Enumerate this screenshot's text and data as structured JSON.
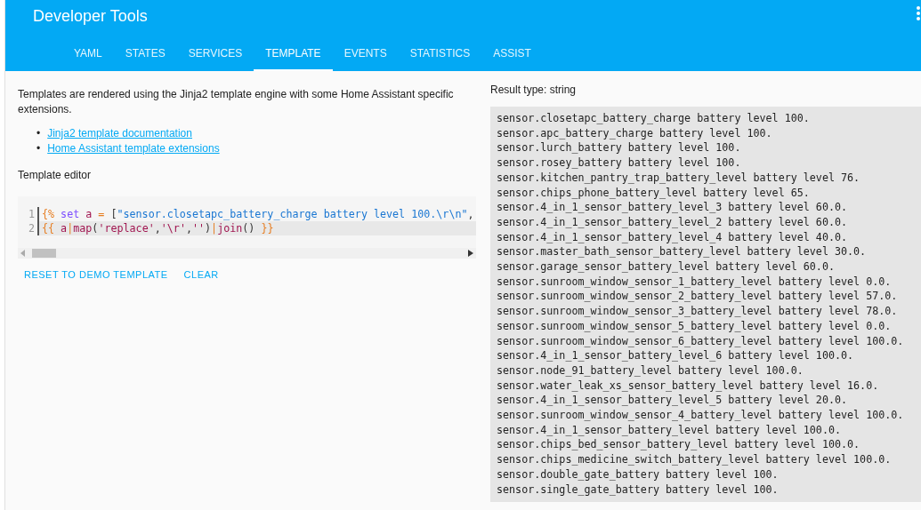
{
  "header": {
    "title": "Developer Tools"
  },
  "tabs": [
    {
      "label": "YAML",
      "selected": false
    },
    {
      "label": "STATES",
      "selected": false
    },
    {
      "label": "SERVICES",
      "selected": false
    },
    {
      "label": "TEMPLATE",
      "selected": true
    },
    {
      "label": "EVENTS",
      "selected": false
    },
    {
      "label": "STATISTICS",
      "selected": false
    },
    {
      "label": "ASSIST",
      "selected": false
    }
  ],
  "intro": "Templates are rendered using the Jinja2 template engine with some Home Assistant specific extensions.",
  "links": [
    {
      "bullet": "•",
      "label": "Jinja2 template documentation"
    },
    {
      "bullet": "•",
      "label": "Home Assistant template extensions"
    }
  ],
  "editor": {
    "label": "Template editor",
    "lines": [
      {
        "number": "1",
        "active": false,
        "tokens": [
          {
            "text": "{%",
            "kind": "delim"
          },
          {
            "text": " set",
            "kind": "keyword"
          },
          {
            "text": " a",
            "kind": "variable"
          },
          {
            "text": " =",
            "kind": "delim"
          },
          {
            "text": " [",
            "kind": "plain"
          },
          {
            "text": "\"sensor.closetapc_battery_charge battery level 100.\\r\\n\"",
            "kind": "string"
          },
          {
            "text": ",",
            "kind": "plain"
          }
        ]
      },
      {
        "number": "2",
        "active": true,
        "tokens": [
          {
            "text": "{{",
            "kind": "delim"
          },
          {
            "text": " a",
            "kind": "variable"
          },
          {
            "text": "|",
            "kind": "delim"
          },
          {
            "text": "map",
            "kind": "variable"
          },
          {
            "text": "(",
            "kind": "plain"
          },
          {
            "text": "'replace'",
            "kind": "variable"
          },
          {
            "text": ",",
            "kind": "plain"
          },
          {
            "text": "'\\r'",
            "kind": "variable"
          },
          {
            "text": ",",
            "kind": "plain"
          },
          {
            "text": "''",
            "kind": "variable"
          },
          {
            "text": ")",
            "kind": "plain"
          },
          {
            "text": "|",
            "kind": "delim"
          },
          {
            "text": "join",
            "kind": "variable"
          },
          {
            "text": "() ",
            "kind": "plain"
          },
          {
            "text": "}}",
            "kind": "delim"
          }
        ]
      }
    ]
  },
  "actions": [
    "RESET TO DEMO TEMPLATE",
    "CLEAR"
  ],
  "result": {
    "type_label": "Result type: string",
    "lines": [
      "sensor.closetapc_battery_charge battery level 100.",
      "sensor.apc_battery_charge battery level 100.",
      "sensor.lurch_battery battery level 100.",
      "sensor.rosey_battery battery level 100.",
      "sensor.kitchen_pantry_trap_battery_level battery level 76.",
      "sensor.chips_phone_battery_level battery level 65.",
      "sensor.4_in_1_sensor_battery_level_3 battery level 60.0.",
      "sensor.4_in_1_sensor_battery_level_2 battery level 60.0.",
      "sensor.4_in_1_sensor_battery_level_4 battery level 40.0.",
      "sensor.master_bath_sensor_battery_level battery level 30.0.",
      "sensor.garage_sensor_battery_level battery level 60.0.",
      "sensor.sunroom_window_sensor_1_battery_level battery level 0.0.",
      "sensor.sunroom_window_sensor_2_battery_level battery level 57.0.",
      "sensor.sunroom_window_sensor_3_battery_level battery level 78.0.",
      "sensor.sunroom_window_sensor_5_battery_level battery level 0.0.",
      "sensor.sunroom_window_sensor_6_battery_level battery level 100.0.",
      "sensor.4_in_1_sensor_battery_level_6 battery level 100.0.",
      "sensor.node_91_battery_level battery level 100.0.",
      "sensor.water_leak_xs_sensor_battery_level battery level 16.0.",
      "sensor.4_in_1_sensor_battery_level_5 battery level 20.0.",
      "sensor.sunroom_window_sensor_4_battery_level battery level 100.0.",
      "sensor.4_in_1_sensor_battery_level battery level 100.0.",
      "sensor.chips_bed_sensor_battery_level battery level 100.0.",
      "sensor.chips_medicine_switch_battery_level battery level 100.0.",
      "sensor.double_gate_battery battery level 100.",
      "sensor.single_gate_battery battery level 100."
    ]
  }
}
